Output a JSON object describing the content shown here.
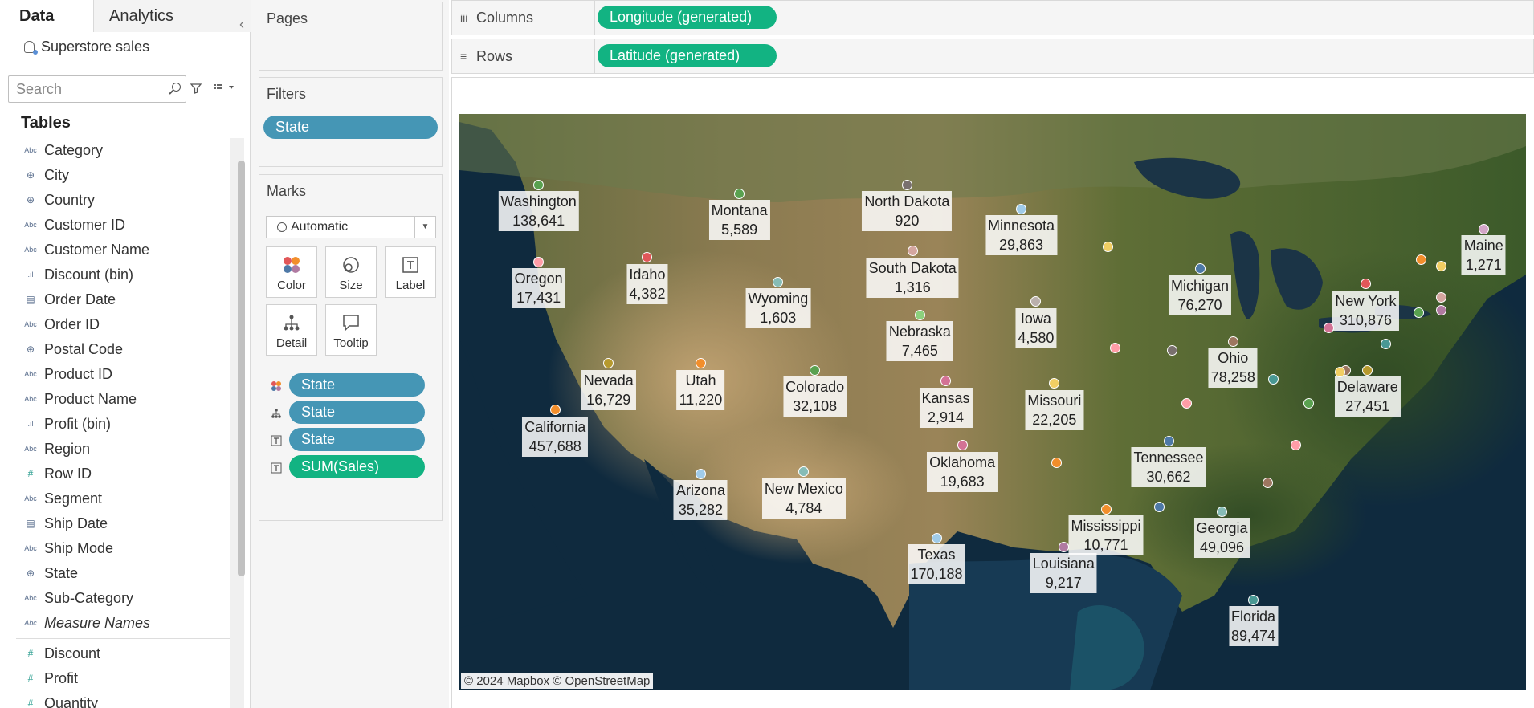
{
  "data_pane": {
    "tabs": [
      "Data",
      "Analytics"
    ],
    "datasource": "Superstore sales",
    "search_placeholder": "Search",
    "tables_title": "Tables",
    "dimensions": [
      {
        "name": "Category",
        "type": "Abc"
      },
      {
        "name": "City",
        "type": "geo"
      },
      {
        "name": "Country",
        "type": "geo"
      },
      {
        "name": "Customer ID",
        "type": "Abc"
      },
      {
        "name": "Customer Name",
        "type": "Abc"
      },
      {
        "name": "Discount (bin)",
        "type": "bin"
      },
      {
        "name": "Order Date",
        "type": "date"
      },
      {
        "name": "Order ID",
        "type": "Abc"
      },
      {
        "name": "Postal Code",
        "type": "geo"
      },
      {
        "name": "Product ID",
        "type": "Abc"
      },
      {
        "name": "Product Name",
        "type": "Abc"
      },
      {
        "name": "Profit (bin)",
        "type": "bin"
      },
      {
        "name": "Region",
        "type": "Abc"
      },
      {
        "name": "Row ID",
        "type": "#"
      },
      {
        "name": "Segment",
        "type": "Abc"
      },
      {
        "name": "Ship Date",
        "type": "date"
      },
      {
        "name": "Ship Mode",
        "type": "Abc"
      },
      {
        "name": "State",
        "type": "geo"
      },
      {
        "name": "Sub-Category",
        "type": "Abc"
      },
      {
        "name": "Measure Names",
        "type": "Abc"
      }
    ],
    "measures": [
      {
        "name": "Discount",
        "type": "#"
      },
      {
        "name": "Profit",
        "type": "#"
      },
      {
        "name": "Quantity",
        "type": "#"
      }
    ]
  },
  "cards": {
    "pages": "Pages",
    "filters": "Filters",
    "filter_pill": "State",
    "marks": "Marks",
    "mark_type": "Automatic",
    "mark_buttons": [
      "Color",
      "Size",
      "Label",
      "Detail",
      "Tooltip"
    ],
    "mark_pills": [
      {
        "icon": "color",
        "label": "State",
        "color": "blue"
      },
      {
        "icon": "detail",
        "label": "State",
        "color": "blue"
      },
      {
        "icon": "label",
        "label": "State",
        "color": "blue"
      },
      {
        "icon": "label",
        "label": "SUM(Sales)",
        "color": "green"
      }
    ]
  },
  "shelves": {
    "columns_label": "Columns",
    "columns_pill": "Longitude (generated)",
    "rows_label": "Rows",
    "rows_pill": "Latitude (generated)"
  },
  "map": {
    "attribution": "© 2024 Mapbox © OpenStreetMap",
    "colors": {
      "blue_pill": "#4596b5",
      "green_pill": "#12b382"
    },
    "states": [
      {
        "name": "Washington",
        "sales": "138,641",
        "lon": -120.5,
        "lat": 47.4,
        "color": "#59a14f",
        "labeled": true
      },
      {
        "name": "Oregon",
        "sales": "17,431",
        "lon": -120.5,
        "lat": 43.9,
        "color": "#ff9da7",
        "labeled": true
      },
      {
        "name": "California",
        "sales": "457,688",
        "lon": -119.6,
        "lat": 37.2,
        "color": "#f28e2b",
        "labeled": true
      },
      {
        "name": "Nevada",
        "sales": "16,729",
        "lon": -116.7,
        "lat": 39.3,
        "color": "#b6992d",
        "labeled": true
      },
      {
        "name": "Idaho",
        "sales": "4,382",
        "lon": -114.6,
        "lat": 44.1,
        "color": "#e15759",
        "labeled": true
      },
      {
        "name": "Montana",
        "sales": "5,589",
        "lon": -109.6,
        "lat": 47.0,
        "color": "#59a14f",
        "labeled": true
      },
      {
        "name": "Wyoming",
        "sales": "1,603",
        "lon": -107.5,
        "lat": 43.0,
        "color": "#86bcb6",
        "labeled": true
      },
      {
        "name": "Utah",
        "sales": "11,220",
        "lon": -111.7,
        "lat": 39.3,
        "color": "#f28e2b",
        "labeled": true
      },
      {
        "name": "Arizona",
        "sales": "35,282",
        "lon": -111.7,
        "lat": 34.3,
        "color": "#a0cbe8",
        "labeled": true
      },
      {
        "name": "Colorado",
        "sales": "32,108",
        "lon": -105.5,
        "lat": 39.0,
        "color": "#59a14f",
        "labeled": true
      },
      {
        "name": "New Mexico",
        "sales": "4,784",
        "lon": -106.1,
        "lat": 34.4,
        "color": "#86bcb6",
        "labeled": true
      },
      {
        "name": "North Dakota",
        "sales": "920",
        "lon": -100.5,
        "lat": 47.4,
        "color": "#79706e",
        "labeled": true
      },
      {
        "name": "South Dakota",
        "sales": "1,316",
        "lon": -100.2,
        "lat": 44.4,
        "color": "#d4a6a0",
        "labeled": true
      },
      {
        "name": "Nebraska",
        "sales": "7,465",
        "lon": -99.8,
        "lat": 41.5,
        "color": "#8cd17d",
        "labeled": true
      },
      {
        "name": "Kansas",
        "sales": "2,914",
        "lon": -98.4,
        "lat": 38.5,
        "color": "#d37295",
        "labeled": true
      },
      {
        "name": "Oklahoma",
        "sales": "19,683",
        "lon": -97.5,
        "lat": 35.6,
        "color": "#d37295",
        "labeled": true
      },
      {
        "name": "Texas",
        "sales": "170,188",
        "lon": -98.9,
        "lat": 31.4,
        "color": "#a0cbe8",
        "labeled": true
      },
      {
        "name": "Minnesota",
        "sales": "29,863",
        "lon": -94.3,
        "lat": 46.3,
        "color": "#a0cbe8",
        "labeled": true
      },
      {
        "name": "Iowa",
        "sales": "4,580",
        "lon": -93.5,
        "lat": 42.1,
        "color": "#bab0ac",
        "labeled": true
      },
      {
        "name": "Missouri",
        "sales": "22,205",
        "lon": -92.5,
        "lat": 38.4,
        "color": "#f1ce63",
        "labeled": true
      },
      {
        "name": "Louisiana",
        "sales": "9,217",
        "lon": -92.0,
        "lat": 31.0,
        "color": "#b07aa1",
        "labeled": true
      },
      {
        "name": "Mississippi",
        "sales": "10,771",
        "lon": -89.7,
        "lat": 32.7,
        "color": "#f28e2b",
        "labeled": true
      },
      {
        "name": "Tennessee",
        "sales": "30,662",
        "lon": -86.3,
        "lat": 35.8,
        "color": "#4e79a7",
        "labeled": true
      },
      {
        "name": "Michigan",
        "sales": "76,270",
        "lon": -84.6,
        "lat": 43.6,
        "color": "#4e79a7",
        "labeled": true
      },
      {
        "name": "Ohio",
        "sales": "78,258",
        "lon": -82.8,
        "lat": 40.3,
        "color": "#9d7660",
        "labeled": true
      },
      {
        "name": "Georgia",
        "sales": "49,096",
        "lon": -83.4,
        "lat": 32.6,
        "color": "#86bcb6",
        "labeled": true
      },
      {
        "name": "Florida",
        "sales": "89,474",
        "lon": -81.7,
        "lat": 28.6,
        "color": "#499894",
        "labeled": true
      },
      {
        "name": "New York",
        "sales": "310,876",
        "lon": -75.6,
        "lat": 42.9,
        "color": "#e15759",
        "labeled": true
      },
      {
        "name": "Delaware",
        "sales": "27,451",
        "lon": -75.5,
        "lat": 39.0,
        "color": "#b6992d",
        "labeled": true
      },
      {
        "name": "Maine",
        "sales": "1,271",
        "lon": -69.2,
        "lat": 45.4,
        "color": "#d4a6c8",
        "labeled": true
      },
      {
        "name": "",
        "sales": "",
        "lon": -89.6,
        "lat": 44.6,
        "color": "#f1ce63",
        "labeled": false
      },
      {
        "name": "",
        "sales": "",
        "lon": -89.2,
        "lat": 40.0,
        "color": "#ff9da7",
        "labeled": false
      },
      {
        "name": "",
        "sales": "",
        "lon": -86.1,
        "lat": 39.9,
        "color": "#79706e",
        "labeled": false
      },
      {
        "name": "",
        "sales": "",
        "lon": -85.3,
        "lat": 37.5,
        "color": "#ff9da7",
        "labeled": false
      },
      {
        "name": "",
        "sales": "",
        "lon": -92.4,
        "lat": 34.8,
        "color": "#f28e2b",
        "labeled": false
      },
      {
        "name": "",
        "sales": "",
        "lon": -86.8,
        "lat": 32.8,
        "color": "#4e79a7",
        "labeled": false
      },
      {
        "name": "",
        "sales": "",
        "lon": -80.6,
        "lat": 38.6,
        "color": "#499894",
        "labeled": false
      },
      {
        "name": "",
        "sales": "",
        "lon": -78.7,
        "lat": 37.5,
        "color": "#59a14f",
        "labeled": false
      },
      {
        "name": "",
        "sales": "",
        "lon": -79.4,
        "lat": 35.6,
        "color": "#ff9da7",
        "labeled": false
      },
      {
        "name": "",
        "sales": "",
        "lon": -80.9,
        "lat": 33.9,
        "color": "#9d7660",
        "labeled": false
      },
      {
        "name": "",
        "sales": "",
        "lon": -77.6,
        "lat": 40.9,
        "color": "#d37295",
        "labeled": false
      },
      {
        "name": "",
        "sales": "",
        "lon": -76.7,
        "lat": 39.0,
        "color": "#9d7660",
        "labeled": false
      },
      {
        "name": "",
        "sales": "",
        "lon": -74.5,
        "lat": 40.2,
        "color": "#499894",
        "labeled": false
      },
      {
        "name": "",
        "sales": "",
        "lon": -72.7,
        "lat": 41.6,
        "color": "#59a14f",
        "labeled": false
      },
      {
        "name": "",
        "sales": "",
        "lon": -72.6,
        "lat": 44.0,
        "color": "#f28e2b",
        "labeled": false
      },
      {
        "name": "",
        "sales": "",
        "lon": -71.5,
        "lat": 43.7,
        "color": "#f1ce63",
        "labeled": false
      },
      {
        "name": "",
        "sales": "",
        "lon": -71.5,
        "lat": 42.3,
        "color": "#d4a6a0",
        "labeled": false
      },
      {
        "name": "",
        "sales": "",
        "lon": -71.5,
        "lat": 41.7,
        "color": "#b07aa1",
        "labeled": false
      },
      {
        "name": "",
        "sales": "",
        "lon": -77.0,
        "lat": 38.9,
        "color": "#f1ce63",
        "labeled": false
      }
    ]
  }
}
